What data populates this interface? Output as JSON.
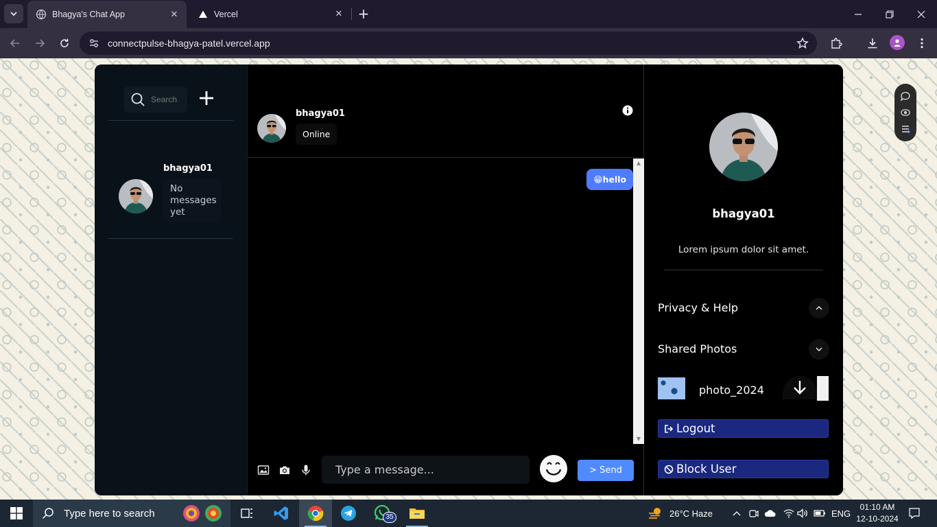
{
  "browser": {
    "active_tab_title": "Bhagya's Chat App",
    "inactive_tab_title": "Vercel",
    "url": "connectpulse-bhagya-patel.vercel.app"
  },
  "sidebar": {
    "search_placeholder": "Search",
    "chats": [
      {
        "name": "bhagya01",
        "preview": "No messages yet"
      }
    ]
  },
  "chat": {
    "contact_name": "bhagya01",
    "contact_status": "Online",
    "messages": [
      {
        "from": "me",
        "emoji": "😁",
        "text": "hello"
      }
    ],
    "input_placeholder": "Type a message...",
    "send_label": "> Send"
  },
  "profile": {
    "name": "bhagya01",
    "bio": "Lorem ipsum dolor sit amet.",
    "sections": [
      {
        "title": "Privacy & Help",
        "expanded": true
      },
      {
        "title": "Shared Photos",
        "expanded": false
      }
    ],
    "shared_photos": [
      {
        "file": "photo_2024"
      }
    ],
    "logout_label": "Logout",
    "block_label": "Block User"
  },
  "taskbar": {
    "search_placeholder": "Type here to search",
    "whatsapp_badge": "35",
    "weather": "26°C  Haze",
    "language": "ENG",
    "time": "01:10 AM",
    "date": "12-10-2024"
  },
  "colors": {
    "accent_blue": "#4f8bff",
    "bubble_blue": "#4f7cff",
    "danger_navy": "#1a2880",
    "panel_dark": "#0a1219"
  }
}
